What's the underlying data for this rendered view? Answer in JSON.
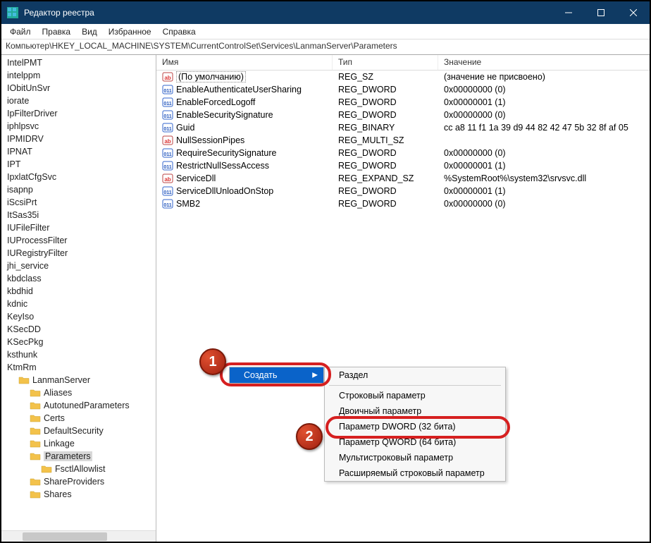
{
  "window": {
    "title": "Редактор реестра"
  },
  "menu": {
    "file": "Файл",
    "edit": "Правка",
    "view": "Вид",
    "favorites": "Избранное",
    "help": "Справка"
  },
  "addressbar": "Компьютер\\HKEY_LOCAL_MACHINE\\SYSTEM\\CurrentControlSet\\Services\\LanmanServer\\Parameters",
  "columns": {
    "name": "Имя",
    "type": "Тип",
    "value": "Значение"
  },
  "tree": [
    {
      "label": "IntelPMT",
      "kind": "key"
    },
    {
      "label": "intelppm",
      "kind": "key"
    },
    {
      "label": "IObitUnSvr",
      "kind": "key"
    },
    {
      "label": "iorate",
      "kind": "key"
    },
    {
      "label": "IpFilterDriver",
      "kind": "key"
    },
    {
      "label": "iphlpsvc",
      "kind": "key"
    },
    {
      "label": "IPMIDRV",
      "kind": "key"
    },
    {
      "label": "IPNAT",
      "kind": "key"
    },
    {
      "label": "IPT",
      "kind": "key"
    },
    {
      "label": "IpxlatCfgSvc",
      "kind": "key"
    },
    {
      "label": "isapnp",
      "kind": "key"
    },
    {
      "label": "iScsiPrt",
      "kind": "key"
    },
    {
      "label": "ItSas35i",
      "kind": "key"
    },
    {
      "label": "IUFileFilter",
      "kind": "key"
    },
    {
      "label": "IUProcessFilter",
      "kind": "key"
    },
    {
      "label": "IURegistryFilter",
      "kind": "key"
    },
    {
      "label": "jhi_service",
      "kind": "key"
    },
    {
      "label": "kbdclass",
      "kind": "key"
    },
    {
      "label": "kbdhid",
      "kind": "key"
    },
    {
      "label": "kdnic",
      "kind": "key"
    },
    {
      "label": "KeyIso",
      "kind": "key"
    },
    {
      "label": "KSecDD",
      "kind": "key"
    },
    {
      "label": "KSecPkg",
      "kind": "key"
    },
    {
      "label": "ksthunk",
      "kind": "key"
    },
    {
      "label": "KtmRm",
      "kind": "key"
    },
    {
      "label": "LanmanServer",
      "kind": "folder"
    },
    {
      "label": "Aliases",
      "kind": "sub"
    },
    {
      "label": "AutotunedParameters",
      "kind": "sub"
    },
    {
      "label": "Certs",
      "kind": "sub"
    },
    {
      "label": "DefaultSecurity",
      "kind": "sub"
    },
    {
      "label": "Linkage",
      "kind": "sub"
    },
    {
      "label": "Parameters",
      "kind": "sub",
      "selected": true
    },
    {
      "label": "FsctlAllowlist",
      "kind": "sub2"
    },
    {
      "label": "ShareProviders",
      "kind": "sub"
    },
    {
      "label": "Shares",
      "kind": "sub"
    }
  ],
  "rows": [
    {
      "icon": "str",
      "name": "(По умолчанию)",
      "type": "REG_SZ",
      "value": "(значение не присвоено)",
      "default": true
    },
    {
      "icon": "bin",
      "name": "EnableAuthenticateUserSharing",
      "type": "REG_DWORD",
      "value": "0x00000000 (0)"
    },
    {
      "icon": "bin",
      "name": "EnableForcedLogoff",
      "type": "REG_DWORD",
      "value": "0x00000001 (1)"
    },
    {
      "icon": "bin",
      "name": "EnableSecuritySignature",
      "type": "REG_DWORD",
      "value": "0x00000000 (0)"
    },
    {
      "icon": "bin",
      "name": "Guid",
      "type": "REG_BINARY",
      "value": "cc a8 11 f1 1a 39 d9 44 82 42 47 5b 32 8f af 05"
    },
    {
      "icon": "str",
      "name": "NullSessionPipes",
      "type": "REG_MULTI_SZ",
      "value": ""
    },
    {
      "icon": "bin",
      "name": "RequireSecuritySignature",
      "type": "REG_DWORD",
      "value": "0x00000000 (0)"
    },
    {
      "icon": "bin",
      "name": "RestrictNullSessAccess",
      "type": "REG_DWORD",
      "value": "0x00000001 (1)"
    },
    {
      "icon": "str",
      "name": "ServiceDll",
      "type": "REG_EXPAND_SZ",
      "value": "%SystemRoot%\\system32\\srvsvc.dll"
    },
    {
      "icon": "bin",
      "name": "ServiceDllUnloadOnStop",
      "type": "REG_DWORD",
      "value": "0x00000001 (1)"
    },
    {
      "icon": "bin",
      "name": "SMB2",
      "type": "REG_DWORD",
      "value": "0x00000000 (0)"
    }
  ],
  "context1": {
    "create": "Создать"
  },
  "context2": {
    "key": "Раздел",
    "string": "Строковый параметр",
    "binary": "Двоичный параметр",
    "dword": "Параметр DWORD (32 бита)",
    "qword": "Параметр QWORD (64 бита)",
    "multi": "Мультистроковый параметр",
    "expand": "Расширяемый строковый параметр"
  },
  "badges": {
    "one": "1",
    "two": "2"
  }
}
